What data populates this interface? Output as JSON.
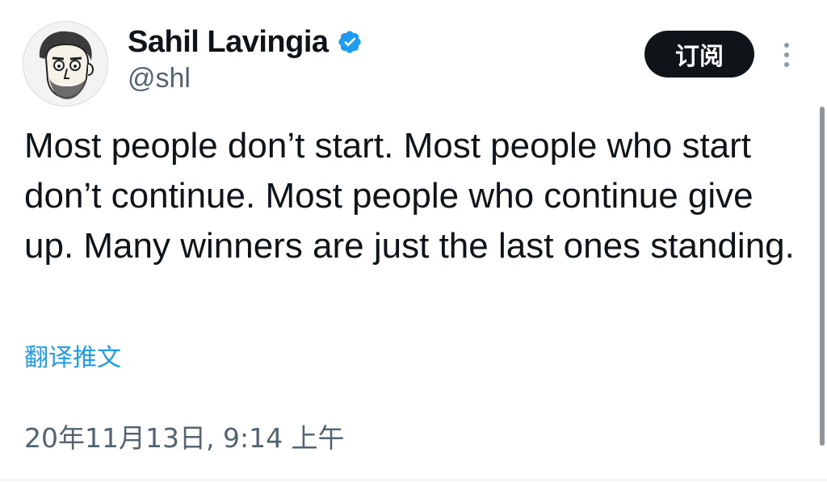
{
  "author": {
    "display_name": "Sahil Lavingia",
    "handle": "@shl",
    "verified": true,
    "verified_color": "#1d9bf0"
  },
  "actions": {
    "subscribe_label": "订阅",
    "more_icon": "more-vertical-icon"
  },
  "tweet": {
    "text": "Most people don’t start. Most people who start don’t continue. Most people who continue give up. Many winners are just the last ones standing.",
    "translate_label": "翻译推文",
    "timestamp": "20年11月13日, 9:14 上午"
  },
  "colors": {
    "text_primary": "#0f1419",
    "text_secondary": "#536471",
    "link": "#1d9bf0",
    "button_bg": "#0f1419"
  }
}
